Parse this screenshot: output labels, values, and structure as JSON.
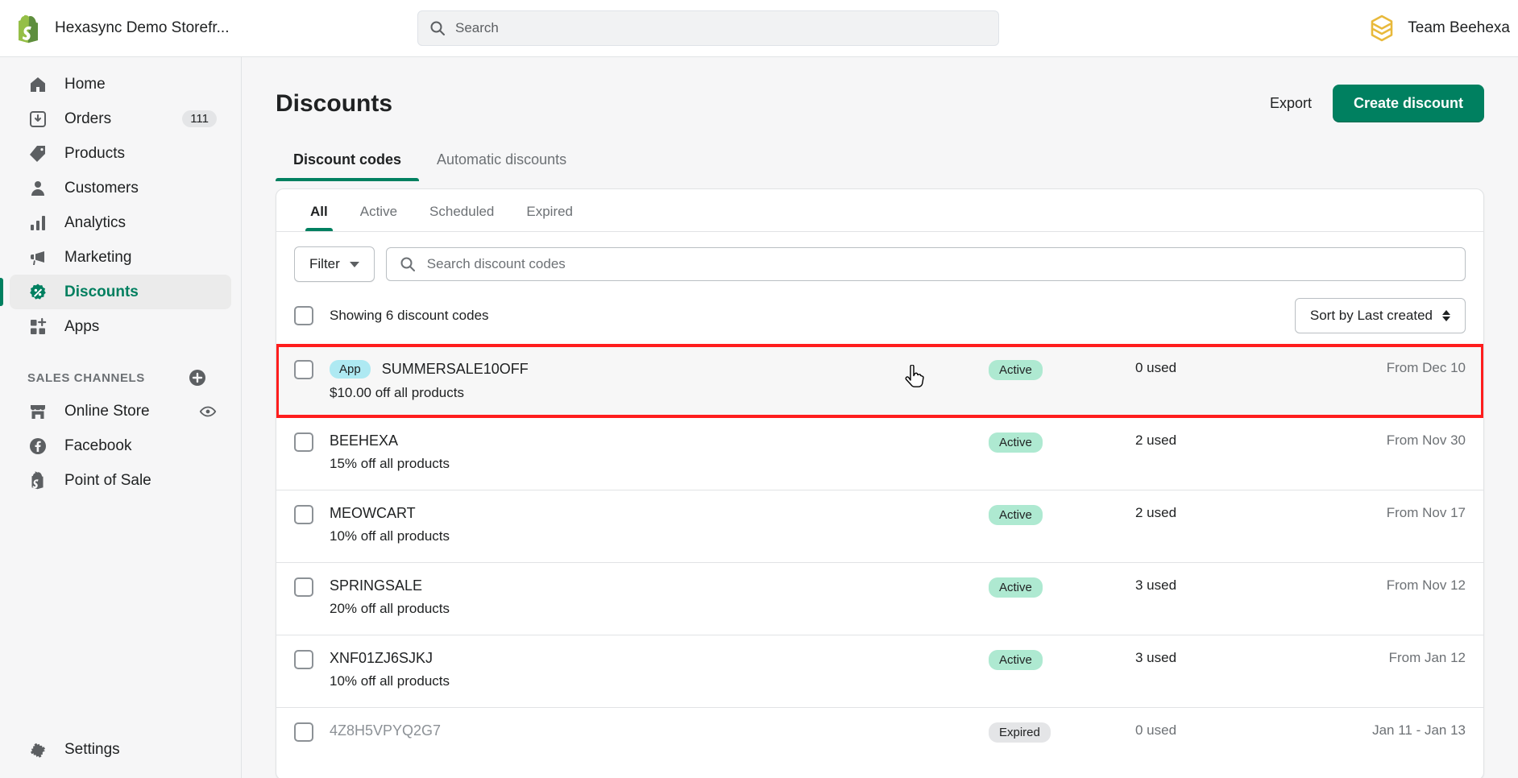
{
  "topbar": {
    "store_name": "Hexasync Demo Storefr...",
    "search_placeholder": "Search",
    "account_name": "Team Beehexa",
    "logo_icon": "shopify-bag-icon",
    "search_icon": "search-icon",
    "avatar_icon": "beehexa-hexagon-icon"
  },
  "sidebar": {
    "items": [
      {
        "label": "Home",
        "icon": "home-icon",
        "badge": ""
      },
      {
        "label": "Orders",
        "icon": "orders-inbox-icon",
        "badge": "111"
      },
      {
        "label": "Products",
        "icon": "products-tag-icon",
        "badge": ""
      },
      {
        "label": "Customers",
        "icon": "customers-person-icon",
        "badge": ""
      },
      {
        "label": "Analytics",
        "icon": "analytics-bars-icon",
        "badge": ""
      },
      {
        "label": "Marketing",
        "icon": "marketing-megaphone-icon",
        "badge": ""
      },
      {
        "label": "Discounts",
        "icon": "discounts-percent-icon",
        "badge": ""
      },
      {
        "label": "Apps",
        "icon": "apps-grid-plus-icon",
        "badge": ""
      }
    ],
    "active_item": "Discounts",
    "sales_channels_title": "SALES CHANNELS",
    "add_channel_icon": "plus-circle-icon",
    "channels": [
      {
        "label": "Online Store",
        "icon": "storefront-icon",
        "trailing_icon": "eye-icon"
      },
      {
        "label": "Facebook",
        "icon": "facebook-icon",
        "trailing_icon": ""
      },
      {
        "label": "Point of Sale",
        "icon": "point-of-sale-bag-icon",
        "trailing_icon": ""
      }
    ],
    "settings": {
      "label": "Settings",
      "icon": "gear-icon"
    }
  },
  "page": {
    "title": "Discounts",
    "export_label": "Export",
    "create_label": "Create discount",
    "tabs": [
      {
        "label": "Discount codes",
        "active": true
      },
      {
        "label": "Automatic discounts",
        "active": false
      }
    ]
  },
  "card": {
    "tabs": [
      {
        "label": "All",
        "active": true
      },
      {
        "label": "Active",
        "active": false
      },
      {
        "label": "Scheduled",
        "active": false
      },
      {
        "label": "Expired",
        "active": false
      }
    ],
    "filter_label": "Filter",
    "search_placeholder": "Search discount codes",
    "showing_text": "Showing 6 discount codes",
    "sort_label": "Sort by Last created",
    "rows": [
      {
        "app_badge": "App",
        "code": "SUMMERSALE10OFF",
        "description": "$10.00 off all products",
        "status": "Active",
        "status_kind": "active",
        "used": "0 used",
        "date": "From Dec 10",
        "highlighted": true,
        "dim": false
      },
      {
        "app_badge": "",
        "code": "BEEHEXA",
        "description": "15% off all products",
        "status": "Active",
        "status_kind": "active",
        "used": "2 used",
        "date": "From Nov 30",
        "highlighted": false,
        "dim": false
      },
      {
        "app_badge": "",
        "code": "MEOWCART",
        "description": "10% off all products",
        "status": "Active",
        "status_kind": "active",
        "used": "2 used",
        "date": "From Nov 17",
        "highlighted": false,
        "dim": false
      },
      {
        "app_badge": "",
        "code": "SPRINGSALE",
        "description": "20% off all products",
        "status": "Active",
        "status_kind": "active",
        "used": "3 used",
        "date": "From Nov 12",
        "highlighted": false,
        "dim": false
      },
      {
        "app_badge": "",
        "code": "XNF01ZJ6SJKJ",
        "description": "10% off all products",
        "status": "Active",
        "status_kind": "active",
        "used": "3 used",
        "date": "From Jan 12",
        "highlighted": false,
        "dim": false
      },
      {
        "app_badge": "",
        "code": "4Z8H5VPYQ2G7",
        "description": "",
        "status": "Expired",
        "status_kind": "expired",
        "used": "0 used",
        "date": "Jan 11 - Jan 13",
        "highlighted": false,
        "dim": true
      }
    ]
  },
  "colors": {
    "brand_green": "#008060",
    "highlight_red": "#ff1d1d",
    "active_badge": "#aee9d1",
    "app_badge": "#aee9f2",
    "expired_badge": "#e4e5e7",
    "accent_yellow": "#e8b93b"
  }
}
